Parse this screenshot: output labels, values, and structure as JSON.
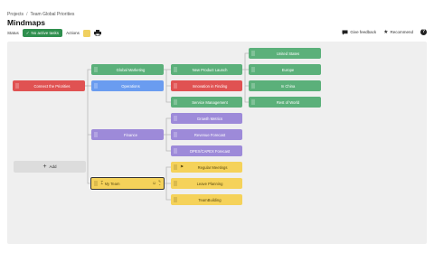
{
  "breadcrumb": {
    "items": [
      "Projects",
      "Team Global Priorities"
    ],
    "separator": "/"
  },
  "page": {
    "title": "Mindmaps"
  },
  "toolbar": {
    "status_label": "Status",
    "status_value": "No active tasks",
    "actions_label": "Actions"
  },
  "header_actions": {
    "feedback": "Give feedback",
    "recommend": "Recommend",
    "help": "?"
  },
  "canvas": {
    "add_label": "Add",
    "nodes": {
      "root": "Connect the Priorities",
      "global_marketing": "Global Marketing",
      "operations": "Operations",
      "finance": "Finance",
      "my_team": "My Team",
      "new_product_launch": "New Product Launch",
      "innovation_in_finding": "Innovation in Finding",
      "service_management": "Service Management",
      "growth_metrics": "Growth Metrics",
      "revenue_forecast": "Revenue Forecast",
      "opex_capex_forecast": "OPEX/CAPEX Forecast",
      "regular_meetings": "Regular Meetings",
      "leave_planning": "Leave Planning",
      "teambuilding": "TeamBuilding",
      "united_states": "United States",
      "europe": "Europe",
      "in_china": "In China",
      "rest_of_world": "Rest of World"
    }
  },
  "colors": {
    "status_green": "#2f8f4e",
    "node_red": "#e05252",
    "node_green": "#5bb07a",
    "node_blue": "#6a9cf0",
    "node_purple": "#9d8ad9",
    "node_yellow": "#f5d25a"
  },
  "icons": [
    "check-icon",
    "printer-icon",
    "feedback-icon",
    "star-icon",
    "help-icon",
    "plus-icon",
    "drag-handle-icon",
    "chevron-down-icon",
    "edit-icon",
    "smile-icon"
  ]
}
